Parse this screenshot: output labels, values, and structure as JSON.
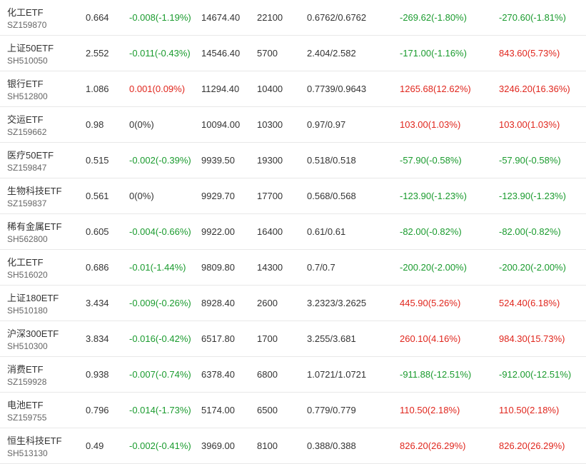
{
  "colors": {
    "up": "#e0261d",
    "down": "#1a9b2e",
    "neutral": "#333333",
    "code": "#666666",
    "divider": "#e8e8e8"
  },
  "rows": [
    {
      "name": "化工ETF",
      "code": "SZ159870",
      "price": "0.664",
      "change": "-0.008(-1.19%)",
      "change_dir": "down",
      "value": "14674.40",
      "shares": "22100",
      "cost": "0.6762/0.6762",
      "pl1": "-269.62(-1.80%)",
      "pl1_dir": "down",
      "pl2": "-270.60(-1.81%)",
      "pl2_dir": "down"
    },
    {
      "name": "上证50ETF",
      "code": "SH510050",
      "price": "2.552",
      "change": "-0.011(-0.43%)",
      "change_dir": "down",
      "value": "14546.40",
      "shares": "5700",
      "cost": "2.404/2.582",
      "pl1": "-171.00(-1.16%)",
      "pl1_dir": "down",
      "pl2": "843.60(5.73%)",
      "pl2_dir": "up"
    },
    {
      "name": "银行ETF",
      "code": "SH512800",
      "price": "1.086",
      "change": "0.001(0.09%)",
      "change_dir": "up",
      "value": "11294.40",
      "shares": "10400",
      "cost": "0.7739/0.9643",
      "pl1": "1265.68(12.62%)",
      "pl1_dir": "up",
      "pl2": "3246.20(16.36%)",
      "pl2_dir": "up"
    },
    {
      "name": "交运ETF",
      "code": "SZ159662",
      "price": "0.98",
      "change": "0(0%)",
      "change_dir": "neutral",
      "value": "10094.00",
      "shares": "10300",
      "cost": "0.97/0.97",
      "pl1": "103.00(1.03%)",
      "pl1_dir": "up",
      "pl2": "103.00(1.03%)",
      "pl2_dir": "up"
    },
    {
      "name": "医疗50ETF",
      "code": "SZ159847",
      "price": "0.515",
      "change": "-0.002(-0.39%)",
      "change_dir": "down",
      "value": "9939.50",
      "shares": "19300",
      "cost": "0.518/0.518",
      "pl1": "-57.90(-0.58%)",
      "pl1_dir": "down",
      "pl2": "-57.90(-0.58%)",
      "pl2_dir": "down"
    },
    {
      "name": "生物科技ETF",
      "code": "SZ159837",
      "price": "0.561",
      "change": "0(0%)",
      "change_dir": "neutral",
      "value": "9929.70",
      "shares": "17700",
      "cost": "0.568/0.568",
      "pl1": "-123.90(-1.23%)",
      "pl1_dir": "down",
      "pl2": "-123.90(-1.23%)",
      "pl2_dir": "down"
    },
    {
      "name": "稀有金属ETF",
      "code": "SH562800",
      "price": "0.605",
      "change": "-0.004(-0.66%)",
      "change_dir": "down",
      "value": "9922.00",
      "shares": "16400",
      "cost": "0.61/0.61",
      "pl1": "-82.00(-0.82%)",
      "pl1_dir": "down",
      "pl2": "-82.00(-0.82%)",
      "pl2_dir": "down"
    },
    {
      "name": "化工ETF",
      "code": "SH516020",
      "price": "0.686",
      "change": "-0.01(-1.44%)",
      "change_dir": "down",
      "value": "9809.80",
      "shares": "14300",
      "cost": "0.7/0.7",
      "pl1": "-200.20(-2.00%)",
      "pl1_dir": "down",
      "pl2": "-200.20(-2.00%)",
      "pl2_dir": "down"
    },
    {
      "name": "上证180ETF",
      "code": "SH510180",
      "price": "3.434",
      "change": "-0.009(-0.26%)",
      "change_dir": "down",
      "value": "8928.40",
      "shares": "2600",
      "cost": "3.2323/3.2625",
      "pl1": "445.90(5.26%)",
      "pl1_dir": "up",
      "pl2": "524.40(6.18%)",
      "pl2_dir": "up"
    },
    {
      "name": "沪深300ETF",
      "code": "SH510300",
      "price": "3.834",
      "change": "-0.016(-0.42%)",
      "change_dir": "down",
      "value": "6517.80",
      "shares": "1700",
      "cost": "3.255/3.681",
      "pl1": "260.10(4.16%)",
      "pl1_dir": "up",
      "pl2": "984.30(15.73%)",
      "pl2_dir": "up"
    },
    {
      "name": "消费ETF",
      "code": "SZ159928",
      "price": "0.938",
      "change": "-0.007(-0.74%)",
      "change_dir": "down",
      "value": "6378.40",
      "shares": "6800",
      "cost": "1.0721/1.0721",
      "pl1": "-911.88(-12.51%)",
      "pl1_dir": "down",
      "pl2": "-912.00(-12.51%)",
      "pl2_dir": "down"
    },
    {
      "name": "电池ETF",
      "code": "SZ159755",
      "price": "0.796",
      "change": "-0.014(-1.73%)",
      "change_dir": "down",
      "value": "5174.00",
      "shares": "6500",
      "cost": "0.779/0.779",
      "pl1": "110.50(2.18%)",
      "pl1_dir": "up",
      "pl2": "110.50(2.18%)",
      "pl2_dir": "up"
    },
    {
      "name": "恒生科技ETF",
      "code": "SH513130",
      "price": "0.49",
      "change": "-0.002(-0.41%)",
      "change_dir": "down",
      "value": "3969.00",
      "shares": "8100",
      "cost": "0.388/0.388",
      "pl1": "826.20(26.29%)",
      "pl1_dir": "up",
      "pl2": "826.20(26.29%)",
      "pl2_dir": "up"
    }
  ]
}
